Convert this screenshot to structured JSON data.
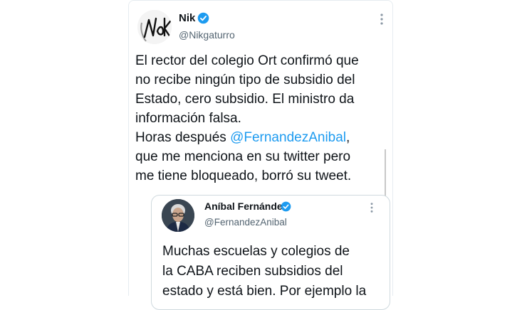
{
  "tweet": {
    "name": "Nik",
    "handle": "@Nikgaturro",
    "avatar_label": "Nik",
    "text_part1": "El rector del colegio Ort confirmó que\nno recibe ningún tipo de subsidio del\nEstado, cero subsidio. El ministro da\ninformación falsa.\nHoras después ",
    "mention": "@FernandezAnibal",
    "text_part2": ",\nque me menciona en su twitter pero\nme tiene bloqueado, borró su tweet."
  },
  "quoted": {
    "name": "Aníbal Fernández",
    "handle": "@FernandezAnibal",
    "text": "Muchas escuelas y colegios de\nla CABA reciben subsidios del\nestado y está bien. Por ejemplo la"
  },
  "colors": {
    "accent": "#1d9bf0",
    "secondary_text": "#536471"
  },
  "icons": [
    "verified-badge-icon",
    "more-options-icon"
  ]
}
